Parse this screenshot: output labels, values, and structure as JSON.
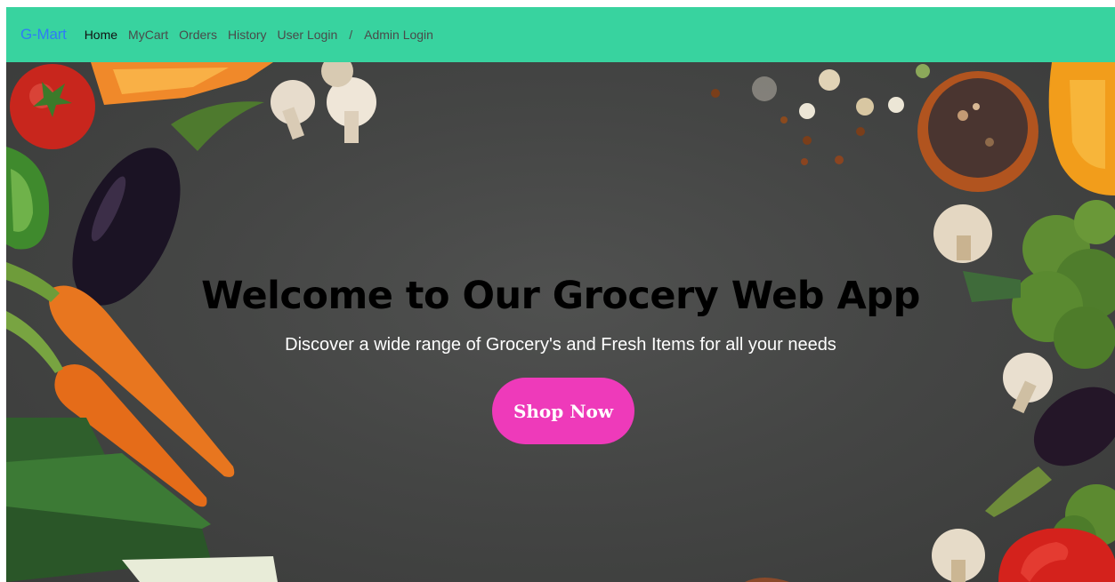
{
  "navbar": {
    "brand": "G-Mart",
    "links": [
      "Home",
      "MyCart",
      "Orders",
      "History",
      "User Login"
    ],
    "separator": "/",
    "admin_link": "Admin Login"
  },
  "hero": {
    "title": "Welcome to Our Grocery Web App",
    "subtitle": "Discover a wide range of Grocery's and Fresh Items for all your needs",
    "cta_label": "Shop Now"
  },
  "colors": {
    "navbar_bg": "#38d39f",
    "brand": "#2f7cf6",
    "cta_bg": "#ee3aba",
    "hero_bg": "#454645"
  }
}
